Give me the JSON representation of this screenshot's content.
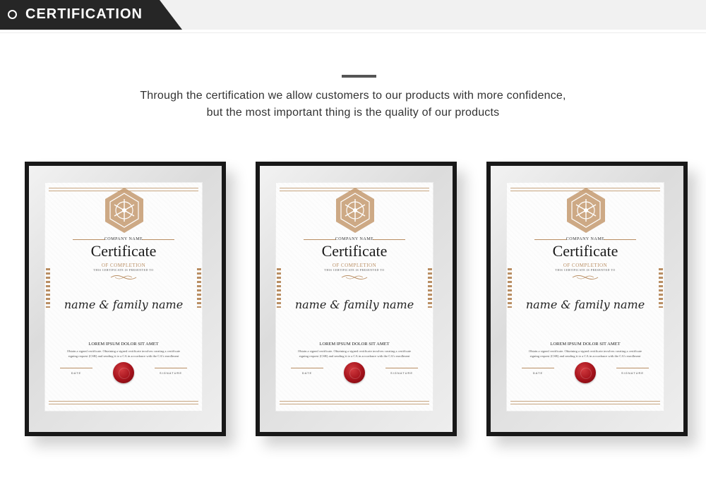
{
  "header": {
    "title": "CERTIFICATION"
  },
  "intro": {
    "line1": "Through the certification we allow customers to our products with more confidence,",
    "line2": "but the most important thing is the quality of our products"
  },
  "colors": {
    "accent_gold": "#b98e63",
    "seal_red": "#a4121b",
    "frame_black": "#181818",
    "header_dark": "#262626"
  },
  "certificates": [
    {
      "company": "COMPANY NAME",
      "title": "Certificate",
      "subtitle": "OF COMPLETION",
      "presented": "THIS CERTIFICATE IS PRESENTED TO",
      "name": "name & family name",
      "heading": "LOREM IPSUM DOLOR SIT AMET",
      "body_line1": "Obtain a signed certificate. Obtaining a signed certificate involves creating a certificate",
      "body_line2": "signing request (CSR) and sending it to a CA in accordance with the CA's enrollment",
      "date_label": "DATE",
      "signature_label": "SIGNATURE"
    },
    {
      "company": "COMPANY NAME",
      "title": "Certificate",
      "subtitle": "OF COMPLETION",
      "presented": "THIS CERTIFICATE IS PRESENTED TO",
      "name": "name & family name",
      "heading": "LOREM IPSUM DOLOR SIT AMET",
      "body_line1": "Obtain a signed certificate. Obtaining a signed certificate involves creating a certificate",
      "body_line2": "signing request (CSR) and sending it to a CA in accordance with the CA's enrollment",
      "date_label": "DATE",
      "signature_label": "SIGNATURE"
    },
    {
      "company": "COMPANY NAME",
      "title": "Certificate",
      "subtitle": "OF COMPLETION",
      "presented": "THIS CERTIFICATE IS PRESENTED TO",
      "name": "name & family name",
      "heading": "LOREM IPSUM DOLOR SIT AMET",
      "body_line1": "Obtain a signed certificate. Obtaining a signed certificate involves creating a certificate",
      "body_line2": "signing request (CSR) and sending it to a CA in accordance with the CA's enrollment",
      "date_label": "DATE",
      "signature_label": "SIGNATURE"
    }
  ]
}
